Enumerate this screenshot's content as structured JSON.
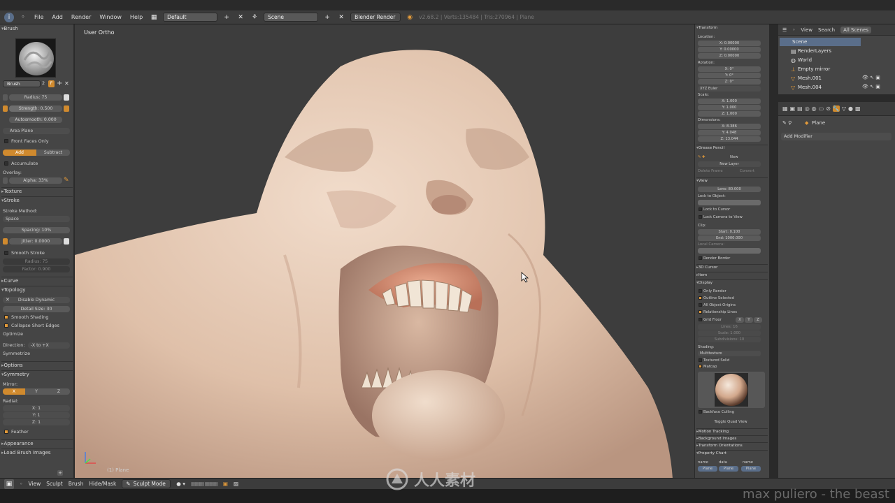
{
  "topbar": {
    "menus": [
      "File",
      "Add",
      "Render",
      "Window",
      "Help"
    ],
    "screen_layout": "Default",
    "scene": "Scene",
    "engine": "Blender Render",
    "info": "v2.68.2 | Verts:135484 | Tris:270964 | Plane"
  },
  "left_panel": {
    "brush_header": "Brush",
    "brush_name": "Brush",
    "brush_users": "2",
    "radius": "Radius: 75",
    "strength": "Strength: 0.500",
    "autosmooth": "Autosmooth: 0.000",
    "sculpt_plane": "Area Plane",
    "front_faces": "Front Faces Only",
    "add": "Add",
    "subtract": "Subtract",
    "accumulate": "Accumulate",
    "overlay": "Overlay:",
    "alpha": "Alpha: 33%",
    "texture": "Texture",
    "stroke": "Stroke",
    "stroke_method_label": "Stroke Method:",
    "stroke_method": "Space",
    "spacing": "Spacing: 10%",
    "jitter": "Jitter: 0.0000",
    "smooth_stroke": "Smooth Stroke",
    "radius2": "Radius: 75",
    "factor": "Factor: 0.900",
    "curve": "Curve",
    "topology": "Topology",
    "disable_dynamic": "Disable Dynamic",
    "detail_size": "Detail Size: 30",
    "smooth_shading": "Smooth Shading",
    "collapse_short": "Collapse Short Edges",
    "optimize": "Optimize",
    "direction_label": "Direction:",
    "direction": "-X to +X",
    "symmetrize": "Symmetrize",
    "options": "Options",
    "symmetry": "Symmetry",
    "mirror": "Mirror:",
    "mx": "X",
    "my": "Y",
    "mz": "Z",
    "radial": "Radial:",
    "rx": "X: 1",
    "ry": "Y: 1",
    "rz": "Z: 1",
    "feather": "Feather",
    "appearance": "Appearance",
    "load_brush": "Load Brush Images"
  },
  "viewport": {
    "view_label": "User Ortho",
    "object_label": "(1) Plane"
  },
  "right_panel": {
    "transform": "Transform",
    "location": "Location:",
    "loc": [
      "X: 0.00000",
      "Y: 0.00000",
      "Z: 0.00000"
    ],
    "rotation": "Rotation:",
    "rot": [
      "X: 0°",
      "Y: 0°",
      "Z: 0°"
    ],
    "euler": "XYZ Euler",
    "scale": "Scale:",
    "scl": [
      "X: 1.000",
      "Y: 1.000",
      "Z: 1.000"
    ],
    "dimensions": "Dimensions:",
    "dim": [
      "X: 8.386",
      "Y: 4.048",
      "Z: 13.044"
    ],
    "grease": "Grease Pencil",
    "new": "New",
    "new_layer": "New Layer",
    "delete_frame": "Delete Frame",
    "convert": "Convert",
    "view": "View",
    "lens": "Lens: 80.000",
    "lock_to_object": "Lock to Object:",
    "lock_cursor": "Lock to Cursor",
    "lock_camera": "Lock Camera to View",
    "clip": "Clip:",
    "clip_start": "Start: 0.100",
    "clip_end": "End: 1000.000",
    "local_camera": "Local Camera:",
    "render_border": "Render Border",
    "cursor3d": "3D Cursor",
    "item": "Item",
    "display": "Display",
    "only_render": "Only Render",
    "outline_selected": "Outline Selected",
    "all_origins": "All Object Origins",
    "relationship": "Relationship Lines",
    "grid_floor": "Grid Floor",
    "gx": "X",
    "gy": "Y",
    "gz": "Z",
    "lines": "Lines: 16",
    "grid_scale": "Scale: 1.000",
    "subdivisions": "Subdivisions: 10",
    "shading": "Shading:",
    "multitexture": "Multitexture",
    "textured_solid": "Textured Solid",
    "matcap": "Matcap",
    "backface": "Backface Culling",
    "toggle_quad": "Toggle Quad View",
    "motion_tracking": "Motion Tracking",
    "background_images": "Background Images",
    "transform_orientations": "Transform Orientations",
    "property_chart": "Property Chart",
    "pc_cols": [
      "name",
      "data",
      "name"
    ],
    "pc_vals": [
      "Plane",
      "Plane",
      "Plane"
    ]
  },
  "outliner": {
    "view": "View",
    "search": "Search",
    "all_scenes": "All Scenes",
    "items": [
      "Scene",
      "RenderLayers",
      "World",
      "Empty mirror",
      "Mesh.001",
      "Mesh.004"
    ]
  },
  "properties": {
    "object": "Plane",
    "add_modifier": "Add Modifier"
  },
  "bottombar": {
    "menus": [
      "View",
      "Sculpt",
      "Brush",
      "Hide/Mask"
    ],
    "mode": "Sculpt Mode"
  },
  "watermark": "max puliero - the beast",
  "logo_text": "人人素材",
  "colors": {
    "accent": "#e29a3a",
    "panel": "#454545",
    "viewport": "#3d3d3d"
  }
}
